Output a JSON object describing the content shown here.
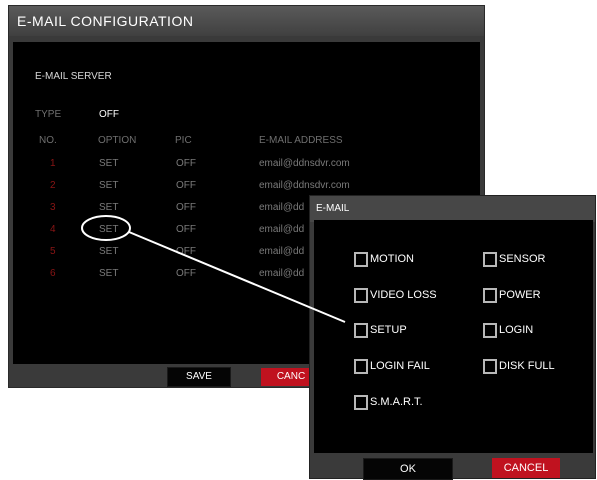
{
  "main_window": {
    "title": "E-MAIL CONFIGURATION",
    "section_title": "E-MAIL SERVER",
    "type_label": "TYPE",
    "type_value": "OFF",
    "columns": [
      "NO.",
      "OPTION",
      "PIC",
      "E-MAIL ADDRESS"
    ],
    "rows": [
      {
        "no": "1",
        "option": "SET",
        "pic": "OFF",
        "email": "email@ddnsdvr.com"
      },
      {
        "no": "2",
        "option": "SET",
        "pic": "OFF",
        "email": "email@ddnsdvr.com"
      },
      {
        "no": "3",
        "option": "SET",
        "pic": "OFF",
        "email": "email@dd"
      },
      {
        "no": "4",
        "option": "SET",
        "pic": "OFF",
        "email": "email@dd"
      },
      {
        "no": "5",
        "option": "SET",
        "pic": "OFF",
        "email": "email@dd"
      },
      {
        "no": "6",
        "option": "SET",
        "pic": "OFF",
        "email": "email@dd"
      }
    ],
    "save_label": "SAVE",
    "cancel_label": "CANC"
  },
  "dialog": {
    "title": "E-MAIL",
    "options": [
      {
        "label": "MOTION",
        "checked": false
      },
      {
        "label": "SENSOR",
        "checked": false
      },
      {
        "label": "VIDEO LOSS",
        "checked": false
      },
      {
        "label": "POWER",
        "checked": false
      },
      {
        "label": "SETUP",
        "checked": false
      },
      {
        "label": "LOGIN",
        "checked": false
      },
      {
        "label": "LOGIN FAIL",
        "checked": false
      },
      {
        "label": "DISK FULL",
        "checked": false
      },
      {
        "label": "S.M.A.R.T.",
        "checked": false
      }
    ],
    "ok_label": "OK",
    "cancel_label": "CANCEL"
  },
  "colors": {
    "accent_red": "#c0121f",
    "row_number_red": "#8a1515",
    "panel_black": "#000000",
    "frame_gray": "#3a3a3a"
  }
}
